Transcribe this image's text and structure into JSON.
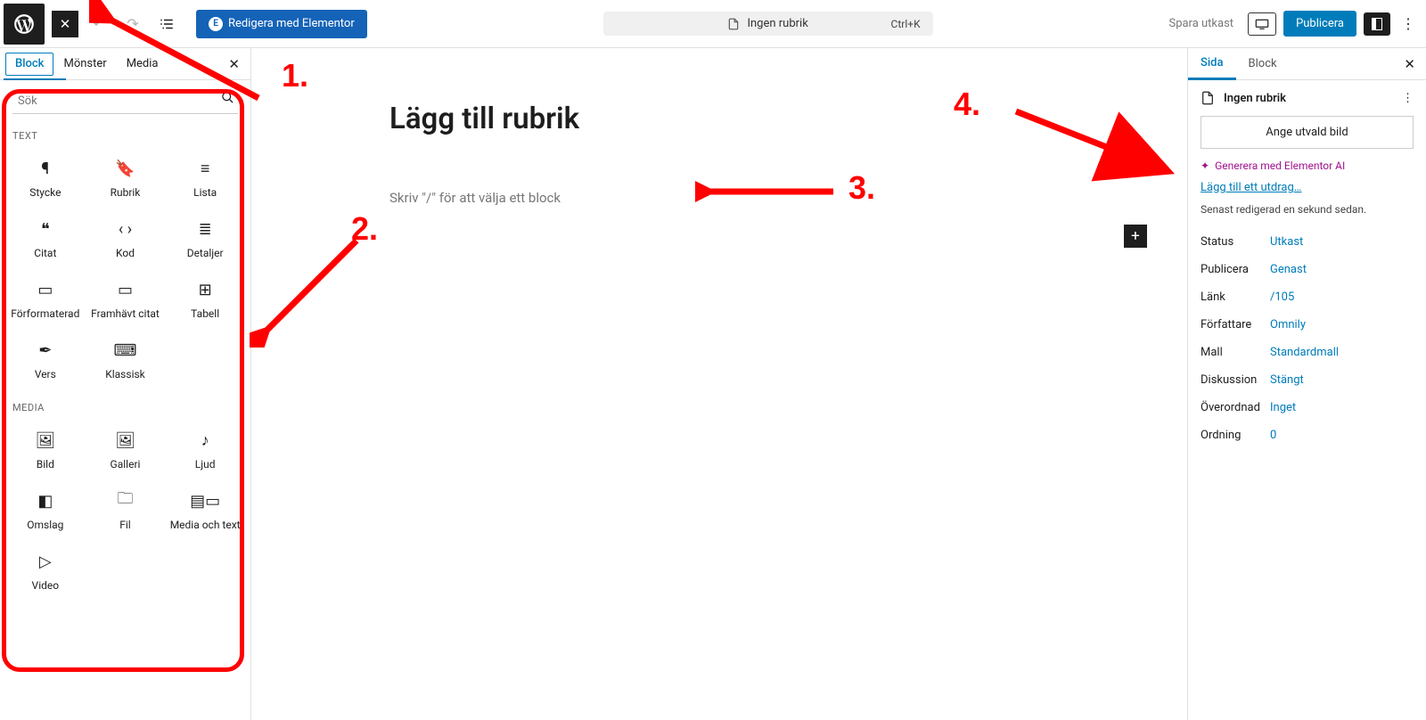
{
  "toolbar": {
    "elementor_label": "Redigera med Elementor",
    "title_label": "Ingen rubrik",
    "shortcut": "Ctrl+K",
    "save_draft": "Spara utkast",
    "publish": "Publicera"
  },
  "inserter": {
    "tabs": {
      "block": "Block",
      "patterns": "Mönster",
      "media": "Media"
    },
    "search_placeholder": "Sök",
    "cat_text": "TEXT",
    "cat_media": "MEDIA",
    "blocks_text": [
      "Stycke",
      "Rubrik",
      "Lista",
      "Citat",
      "Kod",
      "Detaljer",
      "Förformaterad",
      "Framhävt citat",
      "Tabell",
      "Vers",
      "Klassisk"
    ],
    "blocks_media": [
      "Bild",
      "Galleri",
      "Ljud",
      "Omslag",
      "Fil",
      "Media och text",
      "Video"
    ]
  },
  "canvas": {
    "title_placeholder": "Lägg till rubrik",
    "body_placeholder": "Skriv \"/\" för att välja ett block"
  },
  "sidebar": {
    "tab_page": "Sida",
    "tab_block": "Block",
    "doc_title": "Ingen rubrik",
    "featured_image": "Ange utvald bild",
    "ai_link": "Generera med Elementor AI",
    "excerpt_link": "Lägg till ett utdrag…",
    "last_edit": "Senast redigerad en sekund sedan.",
    "rows": {
      "status_l": "Status",
      "status_v": "Utkast",
      "publish_l": "Publicera",
      "publish_v": "Genast",
      "link_l": "Länk",
      "link_v": "/105",
      "author_l": "Författare",
      "author_v": "Omnily",
      "template_l": "Mall",
      "template_v": "Standardmall",
      "discussion_l": "Diskussion",
      "discussion_v": "Stängt",
      "parent_l": "Överordnad",
      "parent_v": "Inget",
      "order_l": "Ordning",
      "order_v": "0"
    }
  },
  "annotations": {
    "n1": "1.",
    "n2": "2.",
    "n3": "3.",
    "n4": "4."
  }
}
